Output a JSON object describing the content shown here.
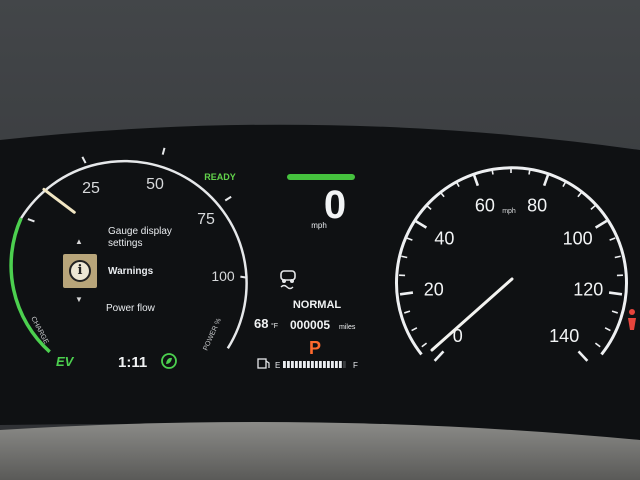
{
  "status": {
    "ready": "READY",
    "drive_mode": "NORMAL"
  },
  "power_meter": {
    "ticks": [
      "25",
      "50",
      "75",
      "100"
    ],
    "label_charge": "CHARGE",
    "label_power": "POWER %",
    "ev_label": "EV",
    "needle_value": 10
  },
  "menu": {
    "items": [
      "Gauge display settings",
      "Warnings",
      "Power flow"
    ],
    "selected": "Warnings"
  },
  "digital_speed": {
    "value": "0",
    "unit": "mph"
  },
  "speedometer": {
    "unit": "mph",
    "ticks": [
      "0",
      "20",
      "40",
      "60",
      "80",
      "100",
      "120",
      "140"
    ],
    "speed": 0
  },
  "trip": {
    "clock": "1:11",
    "temperature": "68",
    "temperature_unit": "°F",
    "odometer": "000005",
    "odometer_unit": "miles"
  },
  "gear": "P",
  "fuel": {
    "empty_label": "E",
    "full_label": "F",
    "level": 0.95
  },
  "colors": {
    "ev_green": "#4cd04f",
    "gear_orange": "#ff6a2e",
    "ready_green": "#62d34b",
    "warning_red": "#e8453c",
    "info_amber": "#b8a57a"
  },
  "icons": [
    "info-icon",
    "eco-mode-icon",
    "traction-control-icon",
    "fuel-pump-icon",
    "seatbelt-warning-icon"
  ]
}
